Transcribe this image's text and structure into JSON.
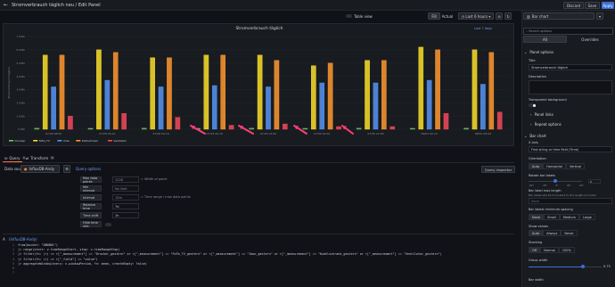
{
  "header": {
    "title": "Stromverbrauch täglich neu / Edit Panel",
    "discard": "Discard",
    "save": "Save",
    "apply": "Apply"
  },
  "viz_toolbar": {
    "table_view": "Table view",
    "fill": "Fill",
    "actual": "Actual",
    "time_range": "Last 6 hours",
    "zoom_icon": "zoom-out-icon",
    "refresh_icon": "refresh-icon"
  },
  "panel": {
    "title": "Stromverbrauch täglich",
    "time_info": "Last 7 days"
  },
  "chart_data": {
    "type": "bar",
    "title": "Stromverbrauch täglich",
    "ylabel": "Stromverbrauch täglich",
    "y_ticks": [
      "7 kWh",
      "6 kWh",
      "5 kWh",
      "4 kWh",
      "3 kWh",
      "2 kWh",
      "1 kWh",
      "0 Wh"
    ],
    "ylim": [
      0,
      7
    ],
    "categories": [
      "07/28 08:00",
      "07/28 00:10",
      "07/28 00:10",
      "07/29 00:10",
      "07/29 12:00",
      "07/30 00:10",
      "07/30 22:00",
      "08/01 00:10",
      "08/01 09:00"
    ],
    "series": [
      {
        "name": "Drucker",
        "color": "#73bf69",
        "values": [
          0.08,
          0.07,
          0.08,
          0.07,
          0.08,
          0.07,
          0.08,
          0.07,
          0.08
        ]
      },
      {
        "name": "FeFe_TV",
        "color": "#fade2a",
        "values": [
          5.6,
          6.0,
          5.4,
          5.6,
          5.6,
          4.8,
          5.2,
          6.2,
          6.0
        ]
      },
      {
        "name": "Imac",
        "color": "#5794f2",
        "values": [
          3.2,
          3.7,
          3.2,
          3.3,
          3.2,
          3.5,
          3.5,
          3.7,
          3.4
        ]
      },
      {
        "name": "Kühlschrank",
        "color": "#ff9830",
        "values": [
          5.6,
          5.8,
          5.4,
          5.6,
          5.2,
          5.0,
          5.2,
          6.0,
          5.8
        ]
      },
      {
        "name": "Ventilator",
        "color": "#f2495c",
        "values": [
          1.0,
          1.2,
          0.9,
          0.3,
          0.4,
          0.2,
          0.2,
          1.2,
          1.3
        ]
      }
    ],
    "legend_position": "bottom-left",
    "grid": true
  },
  "annotations": {
    "arrow_count": 4,
    "arrow_color": "#ff3e7a"
  },
  "tabs": [
    {
      "label": "Query",
      "count": "1"
    },
    {
      "label": "Transform",
      "count": "0"
    }
  ],
  "datasource": {
    "label": "Data source",
    "selected": "InfluxDB-Andy",
    "query_options_label": "Query options",
    "query_inspector": "Query inspector"
  },
  "query_options": {
    "max_data_points": {
      "label": "Max data points",
      "value": "1228",
      "extra": "= Width of panel"
    },
    "min_interval": {
      "label": "Min interval",
      "value": "No limit",
      "extra": ""
    },
    "interval": {
      "label": "Interval",
      "value": "10m",
      "extra": "= Time range / max data points"
    },
    "relative_time": {
      "label": "Relative time",
      "value": "7d",
      "extra": ""
    },
    "time_shift": {
      "label": "Time shift",
      "value": "1h",
      "extra": ""
    },
    "hide_time_info": {
      "label": "Hide time info",
      "value": "",
      "extra": ""
    }
  },
  "query_editor": {
    "ref": "A",
    "datasource": "(InfluxDB-Andy)",
    "lines": [
      "from(bucket: \"DBNB01\")",
      "|> range(start: v.timeRangeStart, stop: v.timeRangeStop)",
      "|> filter(fn: (r) => r[\"_measurement\"] == \"Drucker_gestern\" or r[\"_measurement\"] == \"FeFe_TV_gestern\" or r[\"_measurement\"] == \"Imac_gestern\" or r[\"_measurement\"] == \"Kuehlschrank_gestern\" or r[\"_measurement\"] == \"Ventilator_gestern\")",
      "|> filter(fn: (r) => r[\"_field\"] == \"value\")",
      "|> aggregateWindow(every: v.windowPeriod, fn: mean, createEmpty: false)",
      "",
      ""
    ]
  },
  "sidebar": {
    "viz_type": "Bar chart",
    "search_placeholder": "Search options",
    "tab_all": "All",
    "tab_overrides": "Overrides",
    "panel_options": "Panel options",
    "title_label": "Title",
    "title_value": "Stromverbrauch täglich",
    "description_label": "Description",
    "transparent_label": "Transparent background",
    "panel_links": "Panel links",
    "repeat_options": "Repeat options",
    "bar_chart": "Bar chart",
    "x_axis_label": "X Axis",
    "x_axis_value": "First string or time field (Time)",
    "orientation_label": "Orientation",
    "orientation_options": [
      "Auto",
      "Horizontal",
      "Vertical"
    ],
    "orientation_selected": 0,
    "rotate_label": "Rotate bar labels",
    "rotate_ticks": [
      "-90°",
      "-45°",
      "0°",
      "45°",
      "90°"
    ],
    "rotate_value": 0.5,
    "bar_label_max_label": "Bar label max length",
    "bar_label_max_sub": "Bar labels will be truncated to the length provided",
    "bar_label_max_placeholder": "None",
    "min_spacing_label": "Bar labels minimum spacing",
    "min_spacing_options": [
      "None",
      "Small",
      "Medium",
      "Large"
    ],
    "min_spacing_selected": 0,
    "show_values_label": "Show values",
    "show_values_options": [
      "Auto",
      "Always",
      "Never"
    ],
    "show_values_selected": 0,
    "stacking_label": "Stacking",
    "stacking_options": [
      "Off",
      "Normal",
      "100%"
    ],
    "stacking_selected": 0,
    "group_width_label": "Group width",
    "group_width_value": "0.75",
    "bar_width_label": "Bar width"
  }
}
